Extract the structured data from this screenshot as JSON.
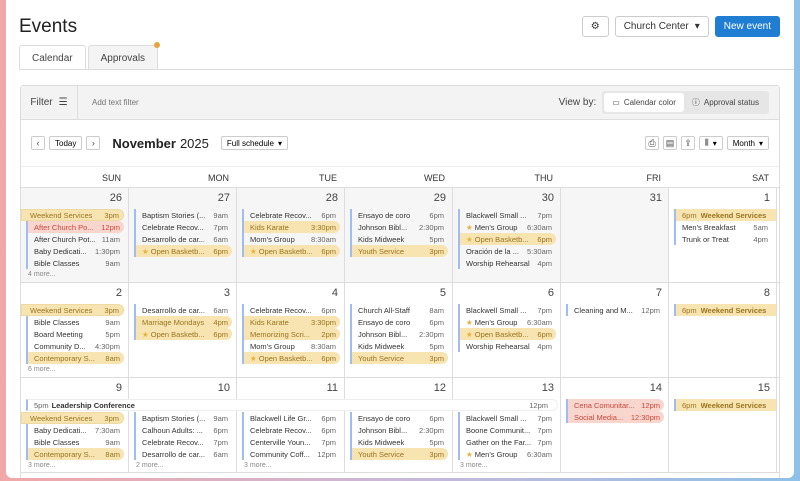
{
  "header": {
    "title": "Events",
    "gear_icon": "gear-icon",
    "org_select": "Church Center",
    "new_event": "New event"
  },
  "tabs": [
    {
      "label": "Calendar",
      "active": true
    },
    {
      "label": "Approvals",
      "badge": true
    }
  ],
  "filter": {
    "label": "Filter",
    "placeholder": "Add text filter",
    "view_by": "View by:",
    "calendar_color": "Calendar color",
    "approval_status": "Approval status"
  },
  "nav": {
    "today": "Today",
    "month": "November",
    "year": "2025",
    "schedule": "Full schedule",
    "view": "Month"
  },
  "colors": {
    "accent": "#1f7ed1",
    "service": "#f7e4b0",
    "alert": "#f8d6ce",
    "bar": "#9fbdf0"
  },
  "days_of_week": [
    "SUN",
    "MON",
    "TUE",
    "WED",
    "THU",
    "FRI",
    "SAT"
  ],
  "weeks": [
    {
      "days": [
        {
          "date": "26",
          "muted": true,
          "more": "4 more...",
          "events": [
            {
              "t": "Weekend Services",
              "tm": "3pm",
              "s": "yw"
            },
            {
              "t": "After Church Po...",
              "tm": "12pm",
              "s": "r"
            },
            {
              "t": "After Church Pot...",
              "tm": "11am",
              "s": "p"
            },
            {
              "t": "Baby Dedicati...",
              "tm": "1:30pm",
              "s": "p"
            },
            {
              "t": "Bible Classes",
              "tm": "9am",
              "s": "p"
            }
          ]
        },
        {
          "date": "27",
          "muted": true,
          "events": [
            {
              "t": "Baptism Stories (...",
              "tm": "9am",
              "s": "p"
            },
            {
              "t": "Celebrate Recov...",
              "tm": "7pm",
              "s": "p"
            },
            {
              "t": "Desarrollo de car...",
              "tm": "6am",
              "s": "p"
            },
            {
              "t": "Open Basketb...",
              "tm": "6pm",
              "s": "y",
              "star": true
            }
          ]
        },
        {
          "date": "28",
          "muted": true,
          "events": [
            {
              "t": "Celebrate Recov...",
              "tm": "6pm",
              "s": "p"
            },
            {
              "t": "Kids Karate",
              "tm": "3:30pm",
              "s": "y"
            },
            {
              "t": "Mom's Group",
              "tm": "8:30am",
              "s": "p"
            },
            {
              "t": "Open Basketb...",
              "tm": "6pm",
              "s": "y",
              "star": true
            }
          ]
        },
        {
          "date": "29",
          "muted": true,
          "events": [
            {
              "t": "Ensayo de coro",
              "tm": "6pm",
              "s": "p"
            },
            {
              "t": "Johnson Bibl...",
              "tm": "2:30pm",
              "s": "p"
            },
            {
              "t": "Kids Midweek",
              "tm": "5pm",
              "s": "p"
            },
            {
              "t": "Youth Service",
              "tm": "3pm",
              "s": "y"
            }
          ]
        },
        {
          "date": "30",
          "muted": true,
          "events": [
            {
              "t": "Blackwell Small ...",
              "tm": "7pm",
              "s": "p"
            },
            {
              "t": "Men's Group",
              "tm": "6:30am",
              "s": "p",
              "star": true
            },
            {
              "t": "Open Basketb...",
              "tm": "6pm",
              "s": "y",
              "star": true
            },
            {
              "t": "Oración de la ...",
              "tm": "5:30am",
              "s": "p"
            },
            {
              "t": "Worship Rehearsal",
              "tm": "4pm",
              "s": "p"
            }
          ]
        },
        {
          "date": "31",
          "muted": true,
          "events": []
        },
        {
          "date": "1",
          "muted": false,
          "events": [
            {
              "t": "Weekend Services",
              "tm": "6pm",
              "s": "ya"
            },
            {
              "t": "Men's Breakfast",
              "tm": "5am",
              "s": "p"
            },
            {
              "t": "Trunk or Treat",
              "tm": "4pm",
              "s": "p"
            }
          ]
        }
      ]
    },
    {
      "days": [
        {
          "date": "2",
          "more": "6 more...",
          "events": [
            {
              "t": "Weekend Services",
              "tm": "3pm",
              "s": "yw"
            },
            {
              "t": "Bible Classes",
              "tm": "9am",
              "s": "p"
            },
            {
              "t": "Board Meeting",
              "tm": "5pm",
              "s": "p"
            },
            {
              "t": "Community D...",
              "tm": "4:30pm",
              "s": "p"
            },
            {
              "t": "Contemporary S...",
              "tm": "8am",
              "s": "y"
            }
          ]
        },
        {
          "date": "3",
          "events": [
            {
              "t": "Desarrollo de car...",
              "tm": "6am",
              "s": "p"
            },
            {
              "t": "Marriage Mondays",
              "tm": "4pm",
              "s": "y"
            },
            {
              "t": "Open Basketb...",
              "tm": "6pm",
              "s": "y",
              "star": true
            }
          ]
        },
        {
          "date": "4",
          "events": [
            {
              "t": "Celebrate Recov...",
              "tm": "6pm",
              "s": "p"
            },
            {
              "t": "Kids Karate",
              "tm": "3:30pm",
              "s": "y"
            },
            {
              "t": "Memorizing Scri...",
              "tm": "2pm",
              "s": "y"
            },
            {
              "t": "Mom's Group",
              "tm": "8:30am",
              "s": "p"
            },
            {
              "t": "Open Basketb...",
              "tm": "6pm",
              "s": "y",
              "star": true
            }
          ]
        },
        {
          "date": "5",
          "events": [
            {
              "t": "Church All-Staff",
              "tm": "8am",
              "s": "p"
            },
            {
              "t": "Ensayo de coro",
              "tm": "6pm",
              "s": "p"
            },
            {
              "t": "Johnson Bibl...",
              "tm": "2:30pm",
              "s": "p"
            },
            {
              "t": "Kids Midweek",
              "tm": "5pm",
              "s": "p"
            },
            {
              "t": "Youth Service",
              "tm": "3pm",
              "s": "y"
            }
          ]
        },
        {
          "date": "6",
          "events": [
            {
              "t": "Blackwell Small ...",
              "tm": "7pm",
              "s": "p"
            },
            {
              "t": "Men's Group",
              "tm": "6:30am",
              "s": "p",
              "star": true
            },
            {
              "t": "Open Basketb...",
              "tm": "6pm",
              "s": "y",
              "star": true
            },
            {
              "t": "Worship Rehearsal",
              "tm": "4pm",
              "s": "p"
            }
          ]
        },
        {
          "date": "7",
          "events": [
            {
              "t": "Cleaning and M...",
              "tm": "12pm",
              "s": "p"
            }
          ]
        },
        {
          "date": "8",
          "events": [
            {
              "t": "Weekend Services",
              "tm": "6pm",
              "s": "ya"
            }
          ]
        }
      ]
    },
    {
      "span": {
        "t": "Leadership Conference",
        "start_time": "5pm",
        "end_time": "12pm"
      },
      "days": [
        {
          "date": "9",
          "more": "3 more...",
          "lane": true,
          "events": [
            {
              "t": "Weekend Services",
              "tm": "3pm",
              "s": "yw"
            },
            {
              "t": "Baby Dedicati...",
              "tm": "7:30am",
              "s": "p"
            },
            {
              "t": "Bible Classes",
              "tm": "9am",
              "s": "p"
            },
            {
              "t": "Contemporary S...",
              "tm": "8am",
              "s": "y"
            }
          ]
        },
        {
          "date": "10",
          "more": "2 more...",
          "lane": true,
          "events": [
            {
              "t": "Baptism Stories (...",
              "tm": "9am",
              "s": "p"
            },
            {
              "t": "Calhoun Adults: ...",
              "tm": "6pm",
              "s": "p"
            },
            {
              "t": "Celebrate Recov...",
              "tm": "7pm",
              "s": "p"
            },
            {
              "t": "Desarrollo de car...",
              "tm": "6am",
              "s": "p"
            }
          ]
        },
        {
          "date": "11",
          "more": "3 more...",
          "lane": true,
          "events": [
            {
              "t": "Blackwell Life Gr...",
              "tm": "6pm",
              "s": "p"
            },
            {
              "t": "Celebrate Recov...",
              "tm": "6pm",
              "s": "p"
            },
            {
              "t": "Centerville Youn...",
              "tm": "7pm",
              "s": "p"
            },
            {
              "t": "Community Coff...",
              "tm": "12pm",
              "s": "p"
            }
          ]
        },
        {
          "date": "12",
          "lane": true,
          "events": [
            {
              "t": "Ensayo de coro",
              "tm": "6pm",
              "s": "p"
            },
            {
              "t": "Johnson Bibl...",
              "tm": "2:30pm",
              "s": "p"
            },
            {
              "t": "Kids Midweek",
              "tm": "5pm",
              "s": "p"
            },
            {
              "t": "Youth Service",
              "tm": "3pm",
              "s": "y"
            }
          ]
        },
        {
          "date": "13",
          "more": "3 more...",
          "lane": true,
          "events": [
            {
              "t": "Blackwell Small ...",
              "tm": "7pm",
              "s": "p"
            },
            {
              "t": "Boone Communit...",
              "tm": "7pm",
              "s": "p"
            },
            {
              "t": "Gather on the Far...",
              "tm": "7pm",
              "s": "p"
            },
            {
              "t": "Men's Group",
              "tm": "6:30am",
              "s": "p",
              "star": true
            }
          ]
        },
        {
          "date": "14",
          "events": [
            {
              "t": "Cena Comunitar...",
              "tm": "12pm",
              "s": "r"
            },
            {
              "t": "Social Media...",
              "tm": "12:30pm",
              "s": "r"
            }
          ]
        },
        {
          "date": "15",
          "events": [
            {
              "t": "Weekend Services",
              "tm": "6pm",
              "s": "ya"
            }
          ]
        }
      ]
    }
  ]
}
